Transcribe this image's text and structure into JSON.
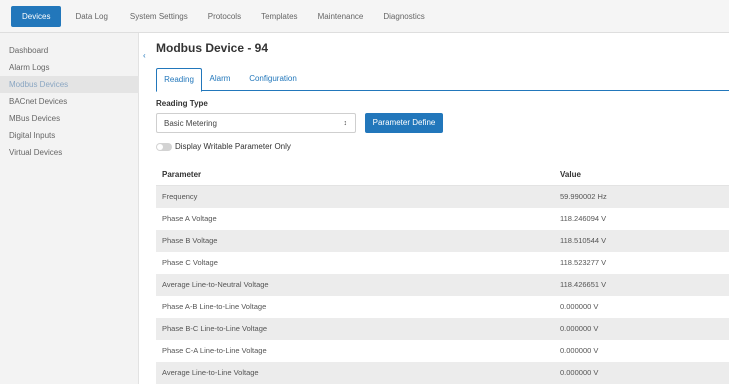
{
  "top_nav": {
    "tabs": [
      {
        "label": "Devices",
        "active": true
      },
      {
        "label": "Data Log",
        "active": false
      },
      {
        "label": "System Settings",
        "active": false
      },
      {
        "label": "Protocols",
        "active": false
      },
      {
        "label": "Templates",
        "active": false
      },
      {
        "label": "Maintenance",
        "active": false
      },
      {
        "label": "Diagnostics",
        "active": false
      }
    ]
  },
  "sidebar": {
    "items": [
      {
        "label": "Dashboard",
        "active": false
      },
      {
        "label": "Alarm Logs",
        "active": false
      },
      {
        "label": "Modbus Devices",
        "active": true
      },
      {
        "label": "BACnet Devices",
        "active": false
      },
      {
        "label": "MBus Devices",
        "active": false
      },
      {
        "label": "Digital Inputs",
        "active": false
      },
      {
        "label": "Virtual Devices",
        "active": false
      }
    ],
    "collapse_icon": "chevron-left-icon"
  },
  "page": {
    "title": "Modbus Device - 94",
    "tabs": [
      {
        "label": "Reading",
        "active": true
      },
      {
        "label": "Alarm",
        "active": false
      },
      {
        "label": "Configuration",
        "active": false
      }
    ]
  },
  "reading": {
    "type_label": "Reading Type",
    "type_value": "Basic Metering",
    "select_icon": "select-arrows-icon",
    "parameter_define_label": "Parameter Define",
    "toggle_label": "Display Writable Parameter Only",
    "toggle_on": false
  },
  "table": {
    "headers": {
      "parameter": "Parameter",
      "value": "Value"
    },
    "rows": [
      {
        "parameter": "Frequency",
        "value": "59.990002 Hz"
      },
      {
        "parameter": "Phase A Voltage",
        "value": "118.246094 V"
      },
      {
        "parameter": "Phase B Voltage",
        "value": "118.510544 V"
      },
      {
        "parameter": "Phase C Voltage",
        "value": "118.523277 V"
      },
      {
        "parameter": "Average Line-to-Neutral Voltage",
        "value": "118.426651 V"
      },
      {
        "parameter": "Phase A-B Line-to-Line Voltage",
        "value": "0.000000 V"
      },
      {
        "parameter": "Phase B-C Line-to-Line Voltage",
        "value": "0.000000 V"
      },
      {
        "parameter": "Phase C-A Line-to-Line Voltage",
        "value": "0.000000 V"
      },
      {
        "parameter": "Average Line-to-Line Voltage",
        "value": "0.000000 V"
      }
    ]
  },
  "colors": {
    "accent": "#2277bb",
    "row_alt": "#ececec",
    "sidebar_bg": "#f3f3f3",
    "sidebar_active_text": "#8aa6c2"
  }
}
